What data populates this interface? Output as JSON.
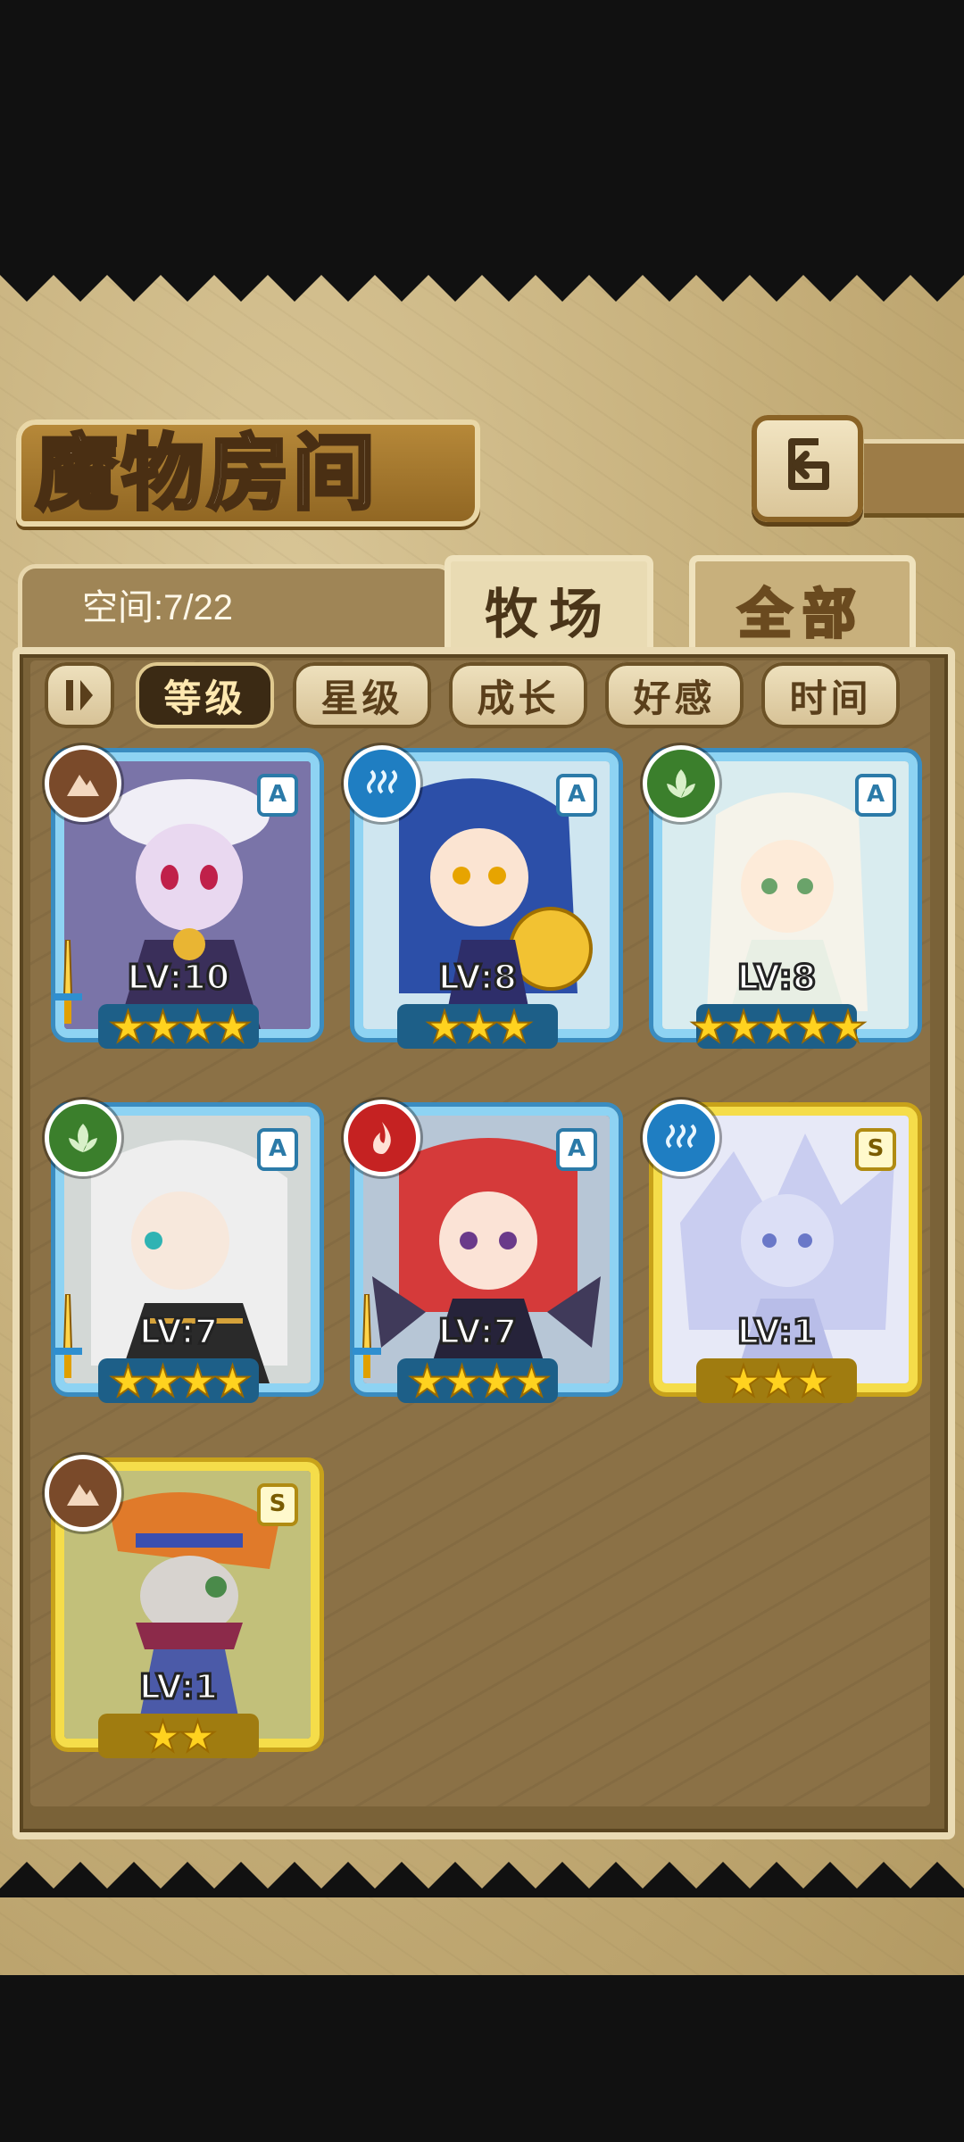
{
  "screen": {
    "title": "魔物房间",
    "space_label": "空间:7/22"
  },
  "tabs": [
    {
      "label": "牧场",
      "active": true
    },
    {
      "label": "全部",
      "active": false
    }
  ],
  "sort_buttons": [
    {
      "label": "等级",
      "active": true
    },
    {
      "label": "星级",
      "active": false
    },
    {
      "label": "成长",
      "active": false
    },
    {
      "label": "好感",
      "active": false
    },
    {
      "label": "时间",
      "active": false
    }
  ],
  "monsters": [
    {
      "level": "LV:10",
      "rank": "A",
      "element": "earth-icon",
      "stars": "★★★★",
      "frame": "blue",
      "weapon": true
    },
    {
      "level": "LV:8",
      "rank": "A",
      "element": "water-icon",
      "stars": "★★★",
      "frame": "blue",
      "weapon": false
    },
    {
      "level": "LV:8",
      "rank": "A",
      "element": "wood-icon",
      "stars": "★★★★★",
      "frame": "blue",
      "weapon": false
    },
    {
      "level": "LV:7",
      "rank": "A",
      "element": "wood-icon",
      "stars": "★★★★",
      "frame": "blue",
      "weapon": true
    },
    {
      "level": "LV:7",
      "rank": "A",
      "element": "fire-icon",
      "stars": "★★★★",
      "frame": "blue",
      "weapon": true
    },
    {
      "level": "LV:1",
      "rank": "S",
      "element": "water-icon",
      "stars": "★★★",
      "frame": "gold",
      "weapon": false
    },
    {
      "level": "LV:1",
      "rank": "S",
      "element": "earth-icon",
      "stars": "★★",
      "frame": "gold",
      "weapon": false
    }
  ],
  "colors": {
    "panel": "#c4ad78",
    "board": "#8b7146",
    "frame_blue": "#8ed3f3",
    "frame_gold": "#f5dd4a",
    "fire": "#c52222",
    "water": "#1f7ec2",
    "wood": "#3b7f2c",
    "earth": "#7a4a2a"
  }
}
